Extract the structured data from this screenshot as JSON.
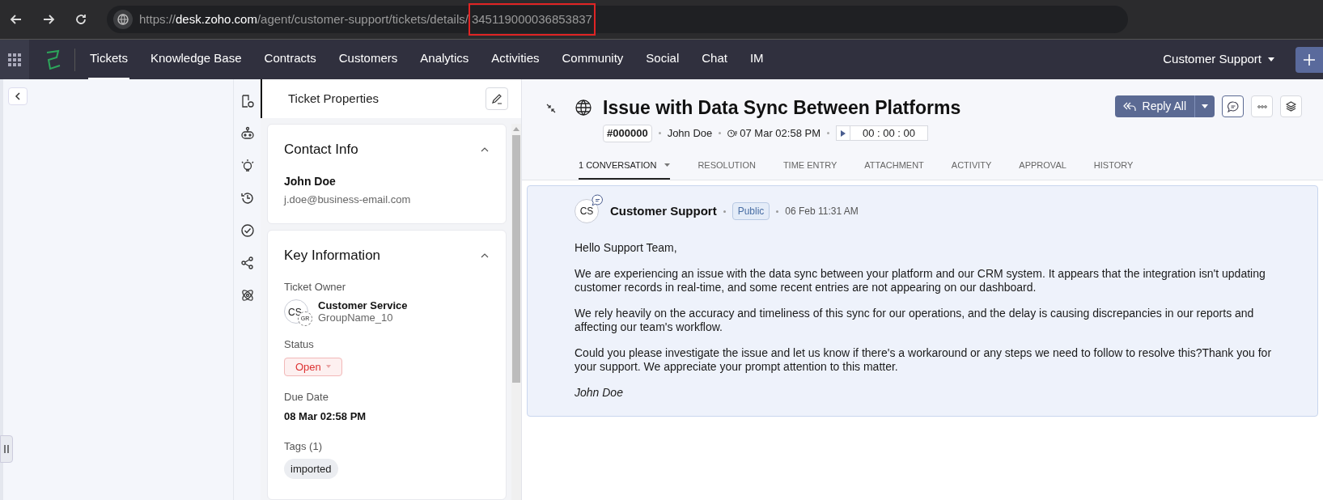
{
  "browser": {
    "url_parts": [
      {
        "kind": "scheme",
        "text": "https://"
      },
      {
        "kind": "domain",
        "text": "desk.zoho.com"
      },
      {
        "kind": "path",
        "text": "/agent/customer-support/tickets/details/"
      },
      {
        "kind": "highlight",
        "text": "345119000036853837"
      }
    ]
  },
  "nav": {
    "items": [
      {
        "label": "Tickets",
        "selected": true
      },
      {
        "label": "Knowledge Base",
        "selected": false
      },
      {
        "label": "Contracts",
        "selected": false
      },
      {
        "label": "Customers",
        "selected": false
      },
      {
        "label": "Analytics",
        "selected": false
      },
      {
        "label": "Activities",
        "selected": false
      },
      {
        "label": "Community",
        "selected": false
      },
      {
        "label": "Social",
        "selected": false
      },
      {
        "label": "Chat",
        "selected": false
      },
      {
        "label": "IM",
        "selected": false
      }
    ],
    "department": "Customer Support"
  },
  "properties": {
    "title": "Ticket Properties",
    "contact_info": {
      "title": "Contact Info",
      "expanded": true,
      "name": "John Doe",
      "email": "j.doe@business-email.com"
    },
    "key_information": {
      "title": "Key Information",
      "expanded": true,
      "owner_label": "Ticket Owner",
      "owner_avatar": "CS",
      "owner_badge": "GR",
      "owner_name": "Customer Service",
      "owner_group": "GroupName_10",
      "status_label": "Status",
      "status": "Open",
      "due_label": "Due Date",
      "due_date": "08 Mar 02:58 PM",
      "tags_label": "Tags (1)",
      "tags": [
        "imported"
      ]
    }
  },
  "ticket": {
    "title": "Issue with Data Sync Between Platforms",
    "id": "#000000",
    "contact": "John Doe",
    "created": "07 Mar 02:58 PM",
    "timer": "00 : 00 : 00",
    "reply_button": "Reply All",
    "tabs": [
      {
        "label": "1 CONVERSATION",
        "selected": true,
        "dropdown": true
      },
      {
        "label": "RESOLUTION",
        "selected": false,
        "dropdown": false
      },
      {
        "label": "TIME ENTRY",
        "selected": false,
        "dropdown": false
      },
      {
        "label": "ATTACHMENT",
        "selected": false,
        "dropdown": false
      },
      {
        "label": "ACTIVITY",
        "selected": false,
        "dropdown": false
      },
      {
        "label": "APPROVAL",
        "selected": false,
        "dropdown": false
      },
      {
        "label": "HISTORY",
        "selected": false,
        "dropdown": false
      }
    ]
  },
  "message": {
    "avatar": "CS",
    "author": "Customer Support",
    "visibility": "Public",
    "time": "06 Feb 11:31 AM",
    "paragraphs": [
      "Hello Support Team,",
      "We are experiencing an issue with the data sync between your platform and our CRM system. It appears that the integration isn't updating customer records in real-time, and some recent entries are not appearing on our dashboard.",
      "We rely heavily on the accuracy and timeliness of this sync for our operations, and the delay is causing discrepancies in our reports and affecting our team's workflow.",
      "Could you please investigate the issue and let us know if there's a workaround or any steps we need to follow to resolve this?Thank you for your support. We appreciate your prompt attention to this matter."
    ],
    "signature": "John Doe"
  }
}
